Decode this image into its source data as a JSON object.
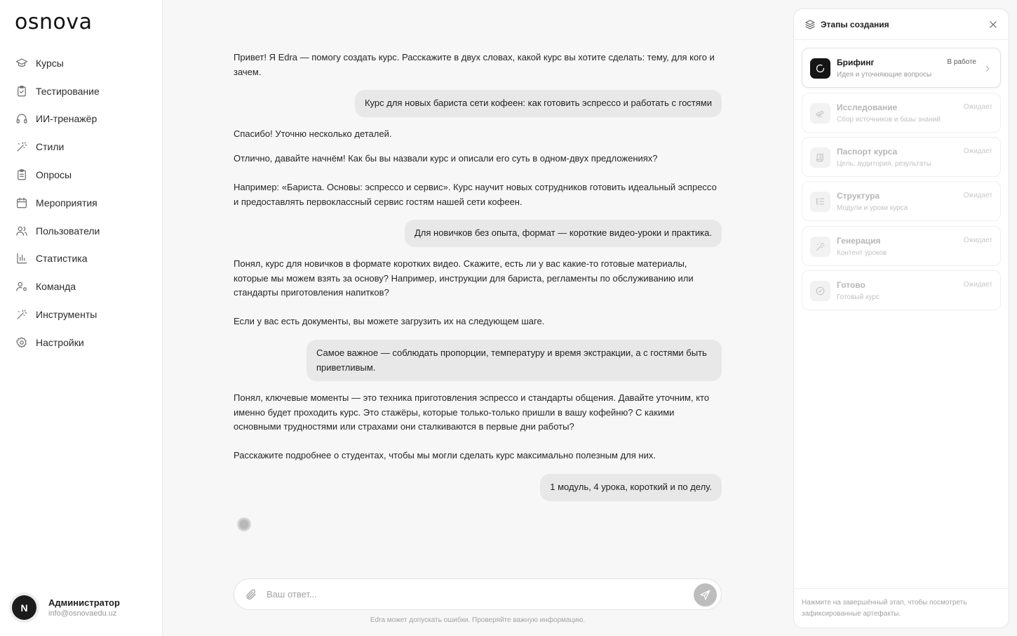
{
  "app": {
    "logo": "osnova"
  },
  "sidebar": {
    "items": [
      {
        "label": "Курсы",
        "icon": "graduation-cap-icon"
      },
      {
        "label": "Тестирование",
        "icon": "clipboard-check-icon"
      },
      {
        "label": "ИИ-тренажёр",
        "icon": "headphones-icon"
      },
      {
        "label": "Стили",
        "icon": "magic-wand-icon"
      },
      {
        "label": "Опросы",
        "icon": "clipboard-list-icon"
      },
      {
        "label": "Мероприятия",
        "icon": "calendar-icon"
      },
      {
        "label": "Пользователи",
        "icon": "users-icon"
      },
      {
        "label": "Статистика",
        "icon": "bar-chart-icon"
      },
      {
        "label": "Команда",
        "icon": "user-cog-icon"
      },
      {
        "label": "Инструменты",
        "icon": "wand-tools-icon"
      },
      {
        "label": "Настройки",
        "icon": "gear-icon"
      }
    ],
    "user": {
      "initial": "N",
      "name": "Администратор",
      "email": "info@osnovaedu.uz"
    }
  },
  "chat": {
    "messages": [
      {
        "role": "bot",
        "paragraphs": [
          "Привет! Я Edra — помогу создать курс. Расскажите в двух словах, какой курс вы хотите сделать: тему, для кого и зачем."
        ]
      },
      {
        "role": "user",
        "text": "Курс для новых бариста сети кофеен: как готовить эспрессо и работать с гостями"
      },
      {
        "role": "bot",
        "paragraphs": [
          "Спасибо! Уточню несколько деталей."
        ]
      },
      {
        "role": "bot",
        "paragraphs": [
          "Отлично, давайте начнём! Как бы вы назвали курс и описали его суть в одном-двух предложениях?",
          "Например: «Бариста. Основы: эспрессо и сервис». Курс научит новых сотрудников готовить идеальный эспрессо и предоставлять первоклассный сервис гостям нашей сети кофеен."
        ]
      },
      {
        "role": "user",
        "text": "Для новичков без опыта, формат — короткие видео-уроки и практика."
      },
      {
        "role": "bot",
        "paragraphs": [
          "Понял, курс для новичков в формате коротких видео. Скажите, есть ли у вас какие-то готовые материалы, которые мы можем взять за основу? Например, инструкции для бариста, регламенты по обслуживанию или стандарты приготовления напитков?",
          "Если у вас есть документы, вы можете загрузить их на следующем шаге."
        ]
      },
      {
        "role": "user",
        "text": "Самое важное — соблюдать пропорции, температуру и время экстракции, а с гостями быть приветливым."
      },
      {
        "role": "bot",
        "paragraphs": [
          "Понял, ключевые моменты — это техника приготовления эспрессо и стандарты общения. Давайте уточним, кто именно будет проходить курс. Это стажёры, которые только-только пришли в вашу кофейню? С какими основными трудностями или страхами они сталкиваются в первые дни работы?",
          "Расскажите подробнее о студентах, чтобы мы могли сделать курс максимально полезным для них."
        ]
      },
      {
        "role": "user",
        "text": "1 модуль, 4 урока, короткий и по делу."
      }
    ],
    "input_placeholder": "Ваш ответ...",
    "disclaimer": "Edra может допускать ошибки. Проверяйте важную информацию."
  },
  "panel": {
    "title": "Этапы создания",
    "stages": [
      {
        "name": "Брифинг",
        "desc": "Идея и уточняющие вопросы",
        "status": "В работе",
        "active": true,
        "icon": "spinner-icon"
      },
      {
        "name": "Исследование",
        "desc": "Сбор источников и базы знаний",
        "status": "Ожидает",
        "active": false,
        "icon": "telescope-icon"
      },
      {
        "name": "Паспорт курса",
        "desc": "Цель, аудитория, результаты",
        "status": "Ожидает",
        "active": false,
        "icon": "scroll-icon"
      },
      {
        "name": "Структура",
        "desc": "Модули и уроки курса",
        "status": "Ожидает",
        "active": false,
        "icon": "list-tree-icon"
      },
      {
        "name": "Генерация",
        "desc": "Контент уроков",
        "status": "Ожидает",
        "active": false,
        "icon": "sparkle-wand-icon"
      },
      {
        "name": "Готово",
        "desc": "Готовый курс",
        "status": "Ожидает",
        "active": false,
        "icon": "check-circle-icon"
      }
    ],
    "footer": "Нажмите на завершённый этап, чтобы посмотреть зафиксированные артефакты."
  }
}
